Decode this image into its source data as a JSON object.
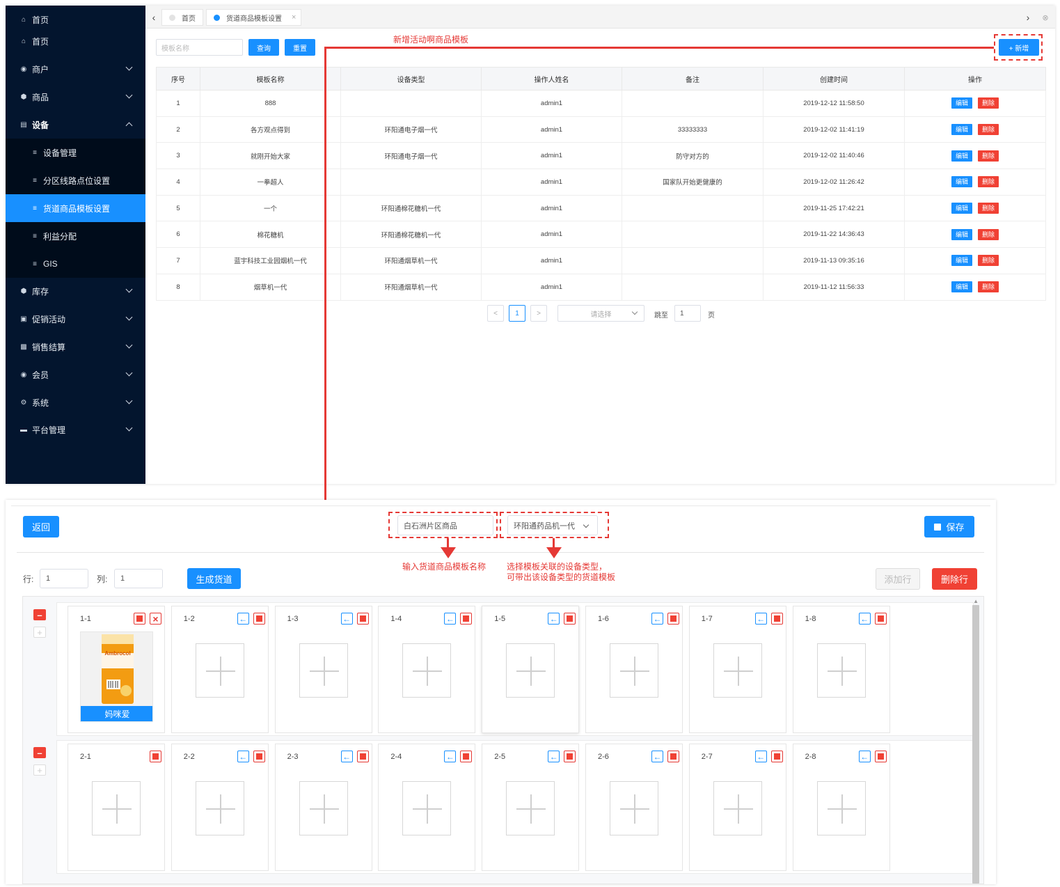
{
  "sidebar": {
    "items": [
      {
        "label": "首页",
        "icon": "home-icon"
      },
      {
        "label": "首页",
        "icon": "home-icon"
      },
      {
        "label": "商户",
        "icon": "user-circle-icon"
      },
      {
        "label": "商品",
        "icon": "cube-icon"
      },
      {
        "label": "设备",
        "icon": "device-icon"
      },
      {
        "label": "设备管理",
        "icon": "list-filter-icon"
      },
      {
        "label": "分区线路点位设置",
        "icon": "list-filter-icon"
      },
      {
        "label": "货道商品模板设置",
        "icon": "list-filter-icon"
      },
      {
        "label": "利益分配",
        "icon": "list-filter-icon"
      },
      {
        "label": "GIS",
        "icon": "list-filter-icon"
      },
      {
        "label": "库存",
        "icon": "cube-icon"
      },
      {
        "label": "促销活动",
        "icon": "lock-icon"
      },
      {
        "label": "销售结算",
        "icon": "briefcase-icon"
      },
      {
        "label": "会员",
        "icon": "coin-icon"
      },
      {
        "label": "系统",
        "icon": "gear-icon"
      },
      {
        "label": "平台管理",
        "icon": "monitor-icon"
      }
    ]
  },
  "tabs": [
    {
      "label": "首页"
    },
    {
      "label": "货道商品模板设置"
    }
  ],
  "search": {
    "placeholder": "模板名称",
    "query_label": "查询",
    "reset_label": "重置",
    "add_label": "+ 新增"
  },
  "table": {
    "columns": [
      "序号",
      "模板名称",
      "设备类型",
      "操作人姓名",
      "备注",
      "创建时间",
      "操作"
    ],
    "rows": [
      [
        "1",
        "888",
        "",
        "admin1",
        "",
        "2019-12-12 11:58:50"
      ],
      [
        "2",
        "各方观点得到",
        "环阳通电子烟一代",
        "admin1",
        "33333333",
        "2019-12-02 11:41:19"
      ],
      [
        "3",
        "就刚开始大家",
        "环阳通电子烟一代",
        "admin1",
        "防守对方的",
        "2019-12-02 11:40:46"
      ],
      [
        "4",
        "一拳超人",
        "",
        "admin1",
        "国家队开始更健康的",
        "2019-12-02 11:26:42"
      ],
      [
        "5",
        "一个",
        "环阳通棉花糖机一代",
        "admin1",
        "",
        "2019-11-25 17:42:21"
      ],
      [
        "6",
        "棉花糖机",
        "环阳通棉花糖机一代",
        "admin1",
        "",
        "2019-11-22 14:36:43"
      ],
      [
        "7",
        "蓝宇科技工业园烟机一代",
        "环阳通烟草机一代",
        "admin1",
        "",
        "2019-11-13 09:35:16"
      ],
      [
        "8",
        "烟草机一代",
        "环阳通烟草机一代",
        "admin1",
        "",
        "2019-11-12 11:56:33"
      ]
    ],
    "edit_label": "编辑",
    "delete_label": "删除"
  },
  "pager": {
    "prev": "<",
    "current": "1",
    "next": ">",
    "page_size_placeholder": "请选择",
    "jump_label": "跳至",
    "jump_value": "1",
    "page_unit": "页"
  },
  "annotations": {
    "add_template": "新增活动啊商品模板",
    "input_name": "输入货道商品模板名称",
    "select_device_line1": "选择模板关联的设备类型，",
    "select_device_line2": "可带出该设备类型的货道模板"
  },
  "editor": {
    "back_label": "返回",
    "template_name_value": "白石洲片区商品",
    "device_type_value": "环阳通药品机一代",
    "save_label": "保存",
    "row_label": "行:",
    "row_value": "1",
    "col_label": "列:",
    "col_value": "1",
    "generate_label": "生成货道",
    "add_row_label": "添加行",
    "delete_row_label": "删除行",
    "product_name": "妈咪爱",
    "product_brand": "Ambrocol"
  },
  "slots": {
    "row1": [
      "1-1",
      "1-2",
      "1-3",
      "1-4",
      "1-5",
      "1-6",
      "1-7",
      "1-8"
    ],
    "row2": [
      "2-1",
      "2-2",
      "2-3",
      "2-4",
      "2-5",
      "2-6",
      "2-7",
      "2-8"
    ]
  },
  "colors": {
    "primary": "#1890ff",
    "danger": "#f04134",
    "sidebar_bg": "#03152e",
    "annotation": "#e53935"
  }
}
